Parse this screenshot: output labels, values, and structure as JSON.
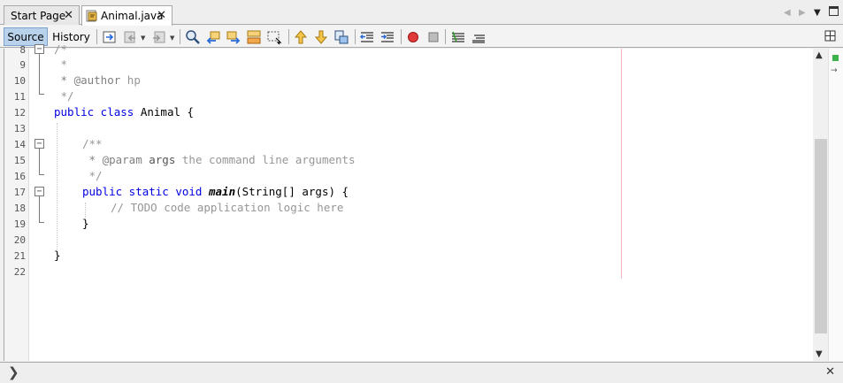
{
  "tabs": [
    {
      "label": "Start Page",
      "close": "✕"
    },
    {
      "label": "Animal.java",
      "close": "✕"
    }
  ],
  "toolbar": {
    "source_label": "Source",
    "history_label": "History"
  },
  "editor": {
    "lines": [
      {
        "num": "8"
      },
      {
        "num": "9"
      },
      {
        "num": "10"
      },
      {
        "num": "11"
      },
      {
        "num": "12"
      },
      {
        "num": "13"
      },
      {
        "num": "14"
      },
      {
        "num": "15"
      },
      {
        "num": "16"
      },
      {
        "num": "17"
      },
      {
        "num": "18"
      },
      {
        "num": "19"
      },
      {
        "num": "20"
      },
      {
        "num": "21"
      },
      {
        "num": "22"
      }
    ],
    "code": {
      "l8": "/*",
      "l9": " *",
      "l10_tag": " * @author",
      "l10_text": " hp",
      "l11": " */",
      "l12_kw": "public class",
      "l12_name": " Animal {",
      "l14": "/**",
      "l15_tag": " * @param",
      "l15_arg": " args",
      "l15_text": " the command line arguments",
      "l16": " */",
      "l17_kw": "public static void",
      "l17_method": "main",
      "l17_rest": "(String[] args) {",
      "l18": "// TODO code application logic here",
      "l19": "}",
      "l21": "}"
    }
  },
  "colors": {
    "keyword": "#0000e6",
    "comment": "#969696",
    "margin_line": "#f4b6b6",
    "status_ok": "#3cb44b"
  }
}
